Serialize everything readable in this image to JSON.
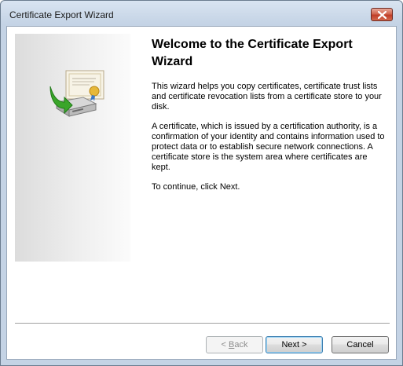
{
  "window": {
    "title": "Certificate Export Wizard"
  },
  "content": {
    "heading": "Welcome to the Certificate Export Wizard",
    "paragraph_1": "This wizard helps you copy certificates, certificate trust lists and certificate revocation lists from a certificate store to your disk.",
    "paragraph_2": "A certificate, which is issued by a certification authority, is a confirmation of your identity and contains information used to protect data or to establish secure network connections. A certificate store is the system area where certificates are kept.",
    "paragraph_3": "To continue, click Next."
  },
  "buttons": {
    "back": {
      "prefix": "< ",
      "mnemonic": "B",
      "rest": "ack",
      "enabled": false
    },
    "next": {
      "label": "Next >",
      "enabled": true
    },
    "cancel": {
      "label": "Cancel",
      "enabled": true
    }
  },
  "icons": {
    "close": "close-icon",
    "illustration": "certificate-export-icon"
  },
  "colors": {
    "close_button": "#c03e28",
    "default_button_border": "#3c7fb1",
    "arrow_green": "#3aa52a"
  }
}
